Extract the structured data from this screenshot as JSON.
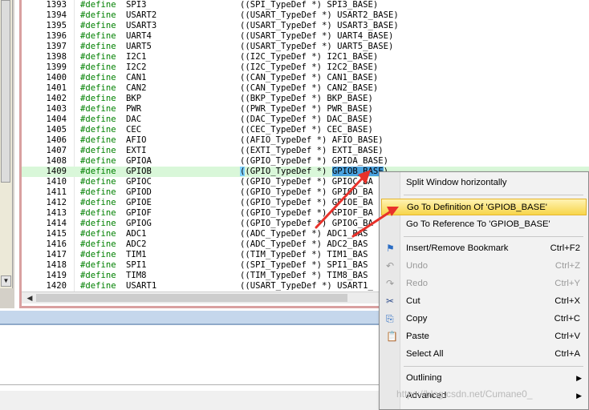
{
  "code": {
    "lines": [
      {
        "ln": "1393",
        "kw": "#define",
        "name": "SPI3",
        "value": "((SPI_TypeDef *) SPI3_BASE)"
      },
      {
        "ln": "1394",
        "kw": "#define",
        "name": "USART2",
        "value": "((USART_TypeDef *) USART2_BASE)"
      },
      {
        "ln": "1395",
        "kw": "#define",
        "name": "USART3",
        "value": "((USART_TypeDef *) USART3_BASE)"
      },
      {
        "ln": "1396",
        "kw": "#define",
        "name": "UART4",
        "value": "((USART_TypeDef *) UART4_BASE)"
      },
      {
        "ln": "1397",
        "kw": "#define",
        "name": "UART5",
        "value": "((USART_TypeDef *) UART5_BASE)"
      },
      {
        "ln": "1398",
        "kw": "#define",
        "name": "I2C1",
        "value": "((I2C_TypeDef *) I2C1_BASE)"
      },
      {
        "ln": "1399",
        "kw": "#define",
        "name": "I2C2",
        "value": "((I2C_TypeDef *) I2C2_BASE)"
      },
      {
        "ln": "1400",
        "kw": "#define",
        "name": "CAN1",
        "value": "((CAN_TypeDef *) CAN1_BASE)"
      },
      {
        "ln": "1401",
        "kw": "#define",
        "name": "CAN2",
        "value": "((CAN_TypeDef *) CAN2_BASE)"
      },
      {
        "ln": "1402",
        "kw": "#define",
        "name": "BKP",
        "value": "((BKP_TypeDef *) BKP_BASE)"
      },
      {
        "ln": "1403",
        "kw": "#define",
        "name": "PWR",
        "value": "((PWR_TypeDef *) PWR_BASE)"
      },
      {
        "ln": "1404",
        "kw": "#define",
        "name": "DAC",
        "value": "((DAC_TypeDef *) DAC_BASE)"
      },
      {
        "ln": "1405",
        "kw": "#define",
        "name": "CEC",
        "value": "((CEC_TypeDef *) CEC_BASE)"
      },
      {
        "ln": "1406",
        "kw": "#define",
        "name": "AFIO",
        "value": "((AFIO_TypeDef *) AFIO_BASE)"
      },
      {
        "ln": "1407",
        "kw": "#define",
        "name": "EXTI",
        "value": "((EXTI_TypeDef *) EXTI_BASE)"
      },
      {
        "ln": "1408",
        "kw": "#define",
        "name": "GPIOA",
        "value": "((GPIO_TypeDef *) GPIOA_BASE)"
      },
      {
        "ln": "1409",
        "kw": "#define",
        "name": "GPIOB",
        "value": "((GPIO_TypeDef *) GPIOB_BASE)",
        "highlight": true
      },
      {
        "ln": "1410",
        "kw": "#define",
        "name": "GPIOC",
        "value": "((GPIO_TypeDef *) GPIOC_BA"
      },
      {
        "ln": "1411",
        "kw": "#define",
        "name": "GPIOD",
        "value": "((GPIO_TypeDef *) GPIOD_BA"
      },
      {
        "ln": "1412",
        "kw": "#define",
        "name": "GPIOE",
        "value": "((GPIO_TypeDef *) GPIOE_BA"
      },
      {
        "ln": "1413",
        "kw": "#define",
        "name": "GPIOF",
        "value": "((GPIO_TypeDef *) GPIOF_BA"
      },
      {
        "ln": "1414",
        "kw": "#define",
        "name": "GPIOG",
        "value": "((GPIO_TypeDef *) GPIOG_BA"
      },
      {
        "ln": "1415",
        "kw": "#define",
        "name": "ADC1",
        "value": "((ADC_TypeDef *) ADC1_BAS"
      },
      {
        "ln": "1416",
        "kw": "#define",
        "name": "ADC2",
        "value": "((ADC_TypeDef *) ADC2_BAS"
      },
      {
        "ln": "1417",
        "kw": "#define",
        "name": "TIM1",
        "value": "((TIM_TypeDef *) TIM1_BAS"
      },
      {
        "ln": "1418",
        "kw": "#define",
        "name": "SPI1",
        "value": "((SPI_TypeDef *) SPI1_BAS"
      },
      {
        "ln": "1419",
        "kw": "#define",
        "name": "TIM8",
        "value": "((TIM_TypeDef *) TIM8_BAS"
      },
      {
        "ln": "1420",
        "kw": "#define",
        "name": "USART1",
        "value": "((USART_TypeDef *) USART1_"
      }
    ]
  },
  "context_menu": {
    "items": [
      {
        "label": "Split Window horizontally",
        "shortcut": "",
        "icon": "",
        "disabled": false
      },
      {
        "separator": true
      },
      {
        "label": "Go To Definition Of 'GPIOB_BASE'",
        "shortcut": "",
        "icon": "",
        "active": true
      },
      {
        "label": "Go To Reference To 'GPIOB_BASE'",
        "shortcut": "",
        "icon": ""
      },
      {
        "separator": true
      },
      {
        "label": "Insert/Remove Bookmark",
        "shortcut": "Ctrl+F2",
        "icon": "bookmark-icon"
      },
      {
        "label": "Undo",
        "shortcut": "Ctrl+Z",
        "icon": "undo-icon",
        "disabled": true
      },
      {
        "label": "Redo",
        "shortcut": "Ctrl+Y",
        "icon": "redo-icon",
        "disabled": true
      },
      {
        "label": "Cut",
        "shortcut": "Ctrl+X",
        "icon": "cut-icon"
      },
      {
        "label": "Copy",
        "shortcut": "Ctrl+C",
        "icon": "copy-icon"
      },
      {
        "label": "Paste",
        "shortcut": "Ctrl+V",
        "icon": "paste-icon"
      },
      {
        "label": "Select All",
        "shortcut": "Ctrl+A",
        "icon": ""
      },
      {
        "separator": true
      },
      {
        "label": "Outlining",
        "shortcut": "",
        "icon": "",
        "submenu": true
      },
      {
        "label": "Advanced",
        "shortcut": "",
        "icon": "",
        "submenu": true
      }
    ]
  },
  "watermark": "https://blog.csdn.net/Cumane0_",
  "colors": {
    "keyword": "#008000",
    "highlight_line": "#d9f7d9",
    "selection": "#4aa3df",
    "menu_active": "#f7d54a",
    "arrow": "#e8312a"
  }
}
